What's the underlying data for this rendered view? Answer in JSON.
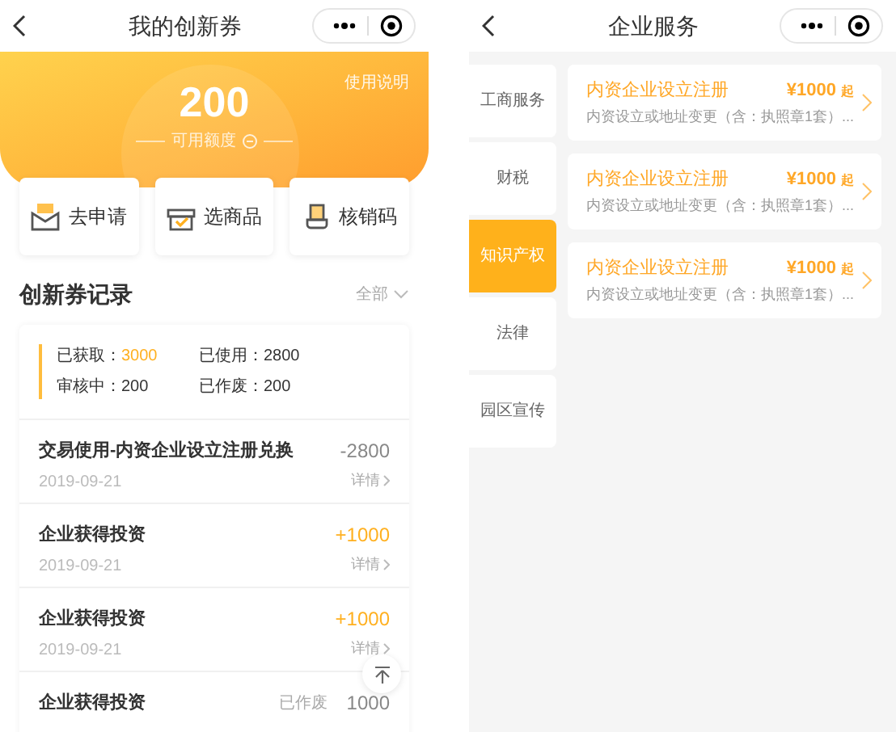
{
  "left": {
    "title": "我的创新券",
    "help_link": "使用说明",
    "amount": "200",
    "amount_label": "可用额度",
    "actions": [
      {
        "label": "去申请",
        "kind": "apply"
      },
      {
        "label": "选商品",
        "kind": "goods"
      },
      {
        "label": "核销码",
        "kind": "code"
      }
    ],
    "records_title": "创新券记录",
    "filter": "全部",
    "summary": [
      {
        "label": "已获取：",
        "value": "3000",
        "highlight": true
      },
      {
        "label": "已使用：",
        "value": "2800",
        "highlight": false
      },
      {
        "label": "审核中：",
        "value": "200",
        "highlight": false
      },
      {
        "label": "已作废：",
        "value": "200",
        "highlight": false
      }
    ],
    "records": [
      {
        "title": "交易使用-内资企业设立注册兑换",
        "date": "2019-09-21",
        "amount": "-2800",
        "kind": "spend",
        "detail": "详情"
      },
      {
        "title": "企业获得投资",
        "date": "2019-09-21",
        "amount": "+1000",
        "kind": "gain",
        "detail": "详情"
      },
      {
        "title": "企业获得投资",
        "date": "2019-09-21",
        "amount": "+1000",
        "kind": "gain",
        "detail": "详情"
      },
      {
        "title": "企业获得投资",
        "amount": "1000",
        "kind": "void",
        "status": "已作废"
      }
    ]
  },
  "right": {
    "title": "企业服务",
    "categories": [
      {
        "label": "工商服务",
        "selected": false
      },
      {
        "label": "财税",
        "selected": false
      },
      {
        "label": "知识产权",
        "selected": true
      },
      {
        "label": "法律",
        "selected": false
      },
      {
        "label": "园区宣传",
        "selected": false
      }
    ],
    "services": [
      {
        "name": "内资企业设立注册",
        "price": "¥1000",
        "suffix": "起",
        "desc": "内资设立或地址变更（含：执照章1套）..."
      },
      {
        "name": "内资企业设立注册",
        "price": "¥1000",
        "suffix": "起",
        "desc": "内资设立或地址变更（含：执照章1套）..."
      },
      {
        "name": "内资企业设立注册",
        "price": "¥1000",
        "suffix": "起",
        "desc": "内资设立或地址变更（含：执照章1套）..."
      }
    ]
  }
}
